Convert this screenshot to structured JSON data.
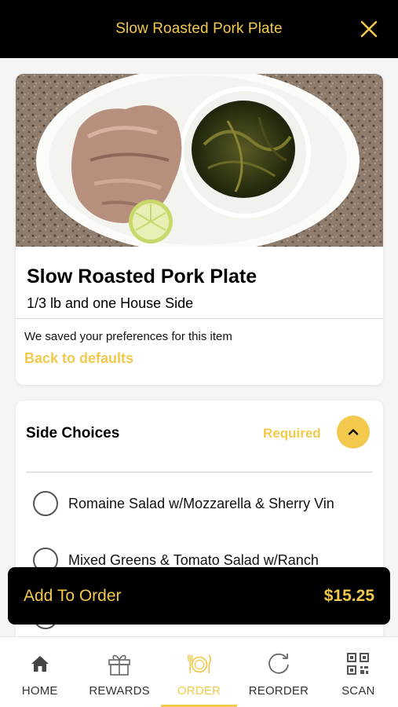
{
  "header": {
    "title": "Slow Roasted Pork Plate"
  },
  "item": {
    "image_alt": "Slow roasted pork with collard greens",
    "title": "Slow Roasted Pork Plate",
    "subtitle": "1/3 lb and one House Side",
    "preferences_note": "We saved your preferences for this item",
    "back_to_defaults": "Back to defaults"
  },
  "side_choices": {
    "title": "Side Choices",
    "required_label": "Required",
    "options": [
      {
        "label": "Romaine Salad w/Mozzarella & Sherry Vin",
        "selected": false
      },
      {
        "label": "Mixed Greens & Tomato Salad w/Ranch",
        "selected": false
      },
      {
        "label": "",
        "selected": false
      }
    ]
  },
  "cart": {
    "add_label": "Add To Order",
    "price": "$15.25"
  },
  "tabs": [
    {
      "label": "HOME",
      "icon": "home-icon",
      "active": false
    },
    {
      "label": "REWARDS",
      "icon": "gift-icon",
      "active": false
    },
    {
      "label": "ORDER",
      "icon": "utensils-plate-icon",
      "active": true
    },
    {
      "label": "REORDER",
      "icon": "refresh-icon",
      "active": false
    },
    {
      "label": "SCAN",
      "icon": "qr-code-icon",
      "active": false
    }
  ],
  "colors": {
    "accent": "#f2c94c",
    "header_bg": "#000000",
    "surface": "#ffffff",
    "background": "#f5f5f5"
  }
}
